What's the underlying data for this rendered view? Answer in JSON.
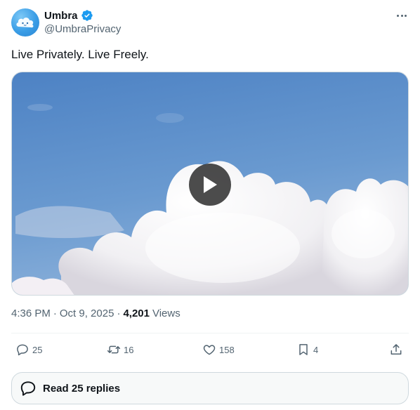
{
  "author": {
    "display_name": "Umbra",
    "handle": "@UmbraPrivacy",
    "verified": true,
    "avatar_icon": "cloud-face-icon",
    "accent_color": "#1d9bf0"
  },
  "tweet": {
    "text": "Live Privately. Live Freely.",
    "media": {
      "type": "video",
      "description_icon": "play-icon"
    },
    "time": "4:36 PM",
    "date": "Oct 9, 2025",
    "separator": "·",
    "views_count": "4,201",
    "views_label": "Views"
  },
  "actions": {
    "replies": "25",
    "reposts": "16",
    "likes": "158",
    "bookmarks": "4"
  },
  "footer": {
    "read_replies_label": "Read 25 replies"
  }
}
